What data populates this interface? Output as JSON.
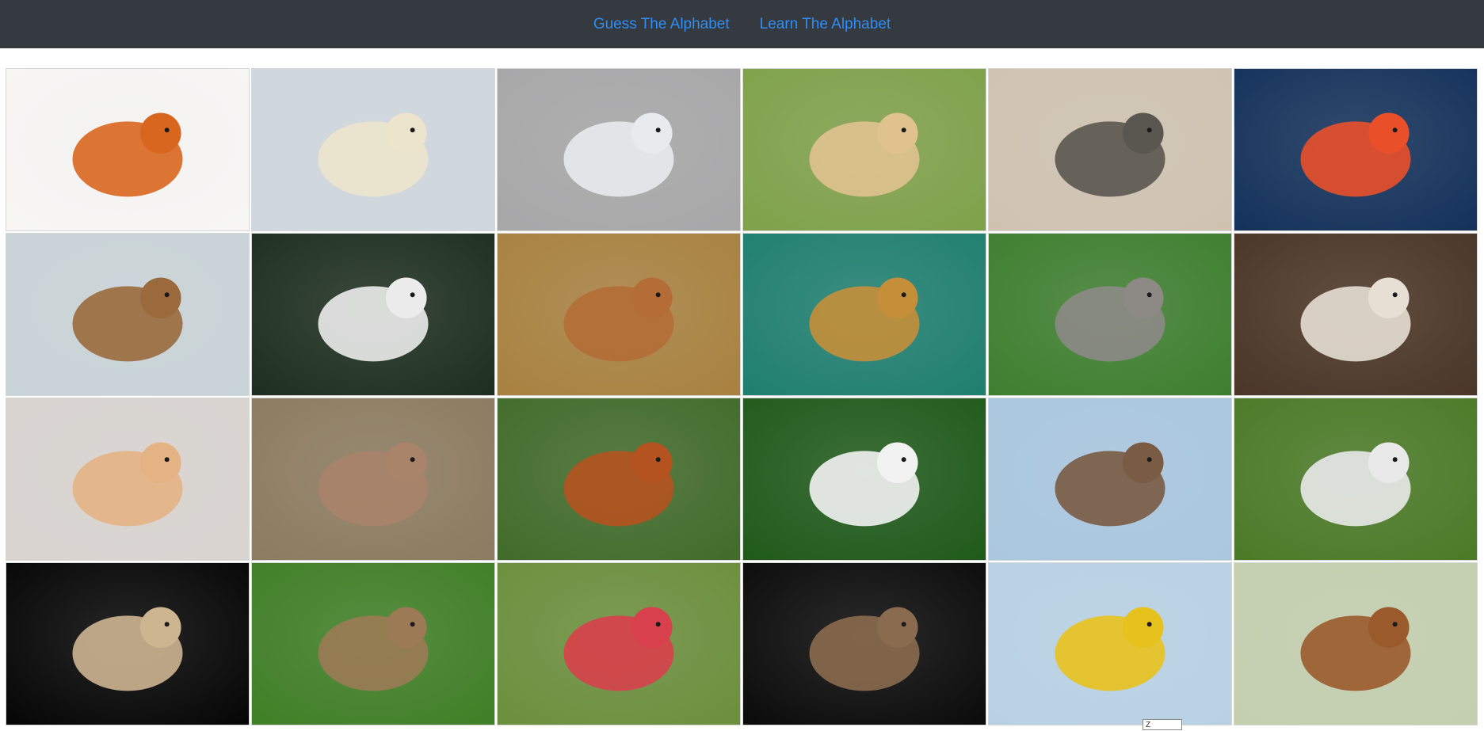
{
  "nav": {
    "links": [
      {
        "label": "Guess The Alphabet"
      },
      {
        "label": "Learn The Alphabet"
      }
    ]
  },
  "tooltip": {
    "text": "Z"
  },
  "cards": [
    {
      "animal": "ant-image",
      "bg": "#f7f6f5",
      "accent": "#d9661e"
    },
    {
      "animal": "polar-bear-image",
      "bg": "#cfd8de",
      "accent": "#ece4cc"
    },
    {
      "animal": "cat-image",
      "bg": "#a7a7a8",
      "accent": "#e9eaed"
    },
    {
      "animal": "golden-retriever-image",
      "bg": "#7fa14a",
      "accent": "#e0c28f"
    },
    {
      "animal": "elephant-image",
      "bg": "#cfc3b0",
      "accent": "#5a5650"
    },
    {
      "animal": "fish-image",
      "bg": "#13315a",
      "accent": "#e9502a"
    },
    {
      "animal": "giraffe-image",
      "bg": "#c9d4d8",
      "accent": "#9a6a3c"
    },
    {
      "animal": "horse-image",
      "bg": "#1d2e1f",
      "accent": "#ececec"
    },
    {
      "animal": "deer-image",
      "bg": "#a8813f",
      "accent": "#b46d36"
    },
    {
      "animal": "jaguar-image",
      "bg": "#1e7f6f",
      "accent": "#c58f3a"
    },
    {
      "animal": "koala-image",
      "bg": "#3e7f2f",
      "accent": "#8d8a86"
    },
    {
      "animal": "lamb-image",
      "bg": "#4a3526",
      "accent": "#e7dfd3"
    },
    {
      "animal": "hamster-image",
      "bg": "#d9d4d0",
      "accent": "#e4b384"
    },
    {
      "animal": "nyala-image",
      "bg": "#8b7b5f",
      "accent": "#a9836a"
    },
    {
      "animal": "orangutan-image",
      "bg": "#416b2a",
      "accent": "#b4531f"
    },
    {
      "animal": "panda-image",
      "bg": "#1f5a1a",
      "accent": "#f2f2f2"
    },
    {
      "animal": "quokka-image",
      "bg": "#a9c7df",
      "accent": "#7a5b43"
    },
    {
      "animal": "rabbit-image",
      "bg": "#4a7a26",
      "accent": "#e9e9ea"
    },
    {
      "animal": "spider-image",
      "bg": "#050505",
      "accent": "#cdb590"
    },
    {
      "animal": "tortoise-image",
      "bg": "#3f7f25",
      "accent": "#9b7a55"
    },
    {
      "animal": "uakari-image",
      "bg": "#6b8f3c",
      "accent": "#d8404b"
    },
    {
      "animal": "vulture-image",
      "bg": "#0a0a0a",
      "accent": "#8a6b4f"
    },
    {
      "animal": "wasp-image",
      "bg": "#b8d2e4",
      "accent": "#e8c21c"
    },
    {
      "animal": "bird-image",
      "bg": "#c3cfae",
      "accent": "#9a5a2c"
    }
  ]
}
